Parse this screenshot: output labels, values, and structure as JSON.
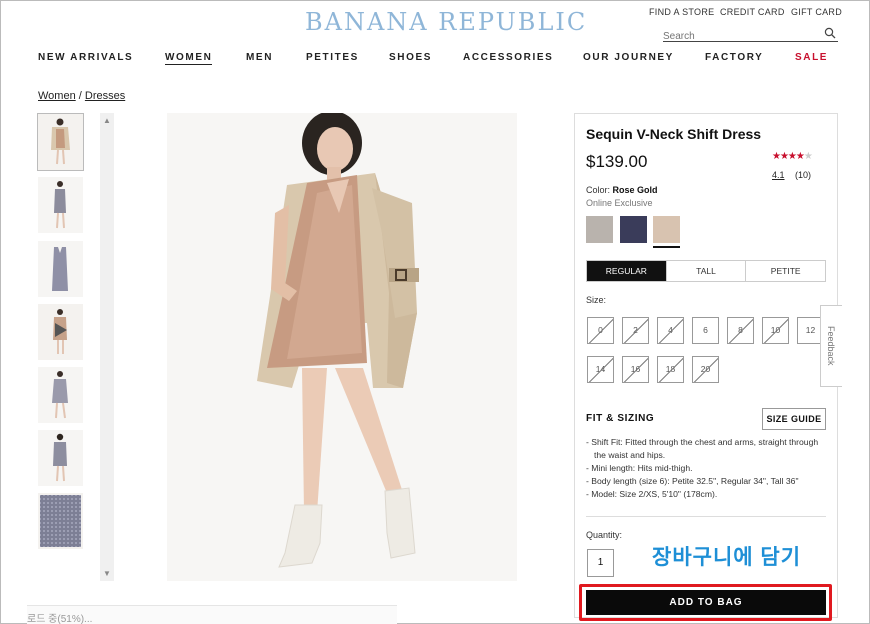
{
  "brand": {
    "logo_text": "BANANA REPUBLIC",
    "logo_color": "#8fb6d8"
  },
  "utility_links": [
    "FIND A STORE",
    "CREDIT CARD",
    "GIFT CARD"
  ],
  "search": {
    "placeholder": "Search",
    "icon": "magnifier-icon"
  },
  "nav": [
    {
      "label": "NEW ARRIVALS",
      "active": false
    },
    {
      "label": "WOMEN",
      "active": true
    },
    {
      "label": "MEN",
      "active": false
    },
    {
      "label": "PETITES",
      "active": false
    },
    {
      "label": "SHOES",
      "active": false
    },
    {
      "label": "ACCESSORIES",
      "active": false
    },
    {
      "label": "OUR JOURNEY",
      "active": false
    },
    {
      "label": "FACTORY",
      "active": false
    },
    {
      "label": "SALE",
      "active": false,
      "color": "#c8102e"
    }
  ],
  "breadcrumb": {
    "items": [
      "Women",
      "Dresses"
    ],
    "separator": "/"
  },
  "gallery": {
    "thumbnail_count": 7,
    "selected_index": 0,
    "video_thumbnail_index": 3,
    "loading_text": "로드 중(51%)..."
  },
  "product": {
    "title": "Sequin V-Neck Shift Dress",
    "price": "$139.00",
    "rating": {
      "value": "4.1",
      "stars_filled": 4,
      "stars_total": 5,
      "count": "(10)"
    },
    "color_label": "Color:",
    "color_value": "Rose Gold",
    "online_exclusive": "Online Exclusive",
    "swatches": [
      {
        "name": "silver",
        "color": "#b9b3ad",
        "selected": false
      },
      {
        "name": "navy",
        "color": "#3a3c5a",
        "selected": false
      },
      {
        "name": "rose-gold",
        "color": "#d8c3b0",
        "selected": true
      }
    ],
    "fits": [
      {
        "label": "REGULAR",
        "selected": true
      },
      {
        "label": "TALL",
        "selected": false
      },
      {
        "label": "PETITE",
        "selected": false
      }
    ],
    "size_label": "Size:",
    "sizes": [
      {
        "label": "0",
        "available": false
      },
      {
        "label": "2",
        "available": false
      },
      {
        "label": "4",
        "available": false
      },
      {
        "label": "6",
        "available": true
      },
      {
        "label": "8",
        "available": false
      },
      {
        "label": "10",
        "available": false
      },
      {
        "label": "12",
        "available": true
      },
      {
        "label": "14",
        "available": false
      },
      {
        "label": "16",
        "available": false
      },
      {
        "label": "18",
        "available": false
      },
      {
        "label": "20",
        "available": false
      }
    ],
    "feedback_tab": "Feedback",
    "fit_sizing_heading": "FIT & SIZING",
    "size_guide_label": "SIZE GUIDE",
    "details": [
      "- Shift Fit: Fitted through the chest and arms, straight through the waist and hips.",
      "- Mini length: Hits mid-thigh.",
      "- Body length (size 6): Petite 32.5\", Regular 34\", Tall 36\"",
      "- Model: Size 2/XS, 5'10\" (178cm)."
    ],
    "quantity_label": "Quantity:",
    "quantity_value": "1",
    "add_to_bag_label": "ADD TO BAG"
  },
  "annotation": {
    "text": "장바구니에 담기",
    "color": "#1e8fd6",
    "highlight_color": "#e0191f"
  }
}
